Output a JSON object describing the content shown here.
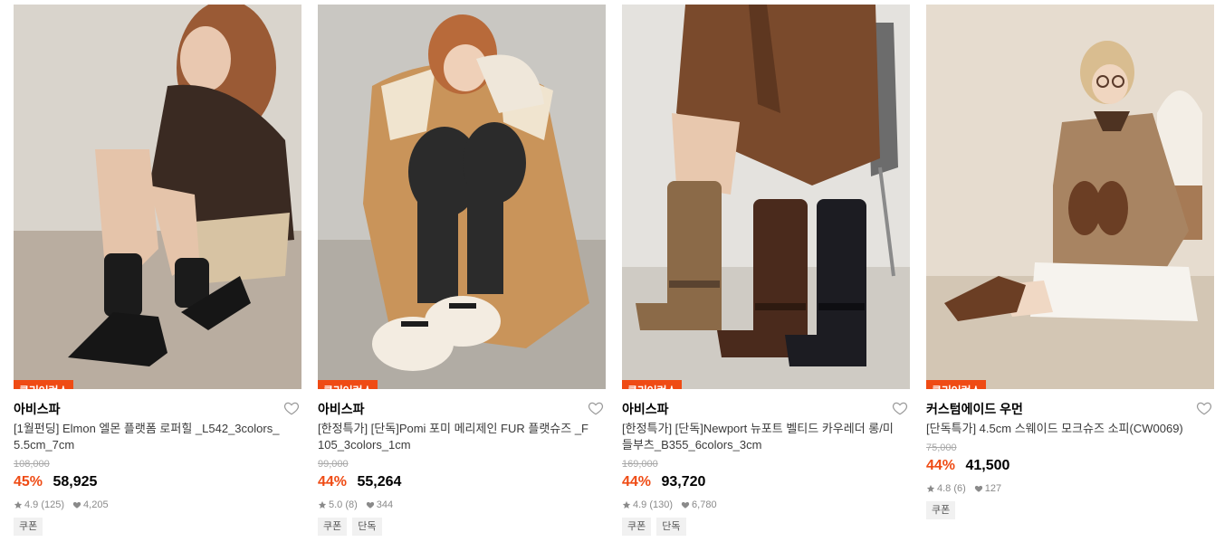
{
  "products": [
    {
      "badge": "클리어런스",
      "brand": "아비스파",
      "title": "[1월펀딩] Elmon 엘몬 플랫폼 로퍼힐 _L542_3colors_5.5cm_7cm",
      "original_price": "108,000",
      "discount": "45%",
      "price": "58,925",
      "rating": "4.9 (125)",
      "likes": "4,205",
      "tags": [
        "쿠폰"
      ]
    },
    {
      "badge": "클리어런스",
      "brand": "아비스파",
      "title": "[한정특가] [단독]Pomi 포미 메리제인 FUR 플랫슈즈 _F105_3colors_1cm",
      "original_price": "99,000",
      "discount": "44%",
      "price": "55,264",
      "rating": "5.0 (8)",
      "likes": "344",
      "tags": [
        "쿠폰",
        "단독"
      ]
    },
    {
      "badge": "클리어런스",
      "brand": "아비스파",
      "title": "[한정특가] [단독]Newport 뉴포트 벨티드 카우레더 롱/미들부츠_B355_6colors_3cm",
      "original_price": "169,000",
      "discount": "44%",
      "price": "93,720",
      "rating": "4.9 (130)",
      "likes": "6,780",
      "tags": [
        "쿠폰",
        "단독"
      ]
    },
    {
      "badge": "클리어런스",
      "brand": "커스텀에이드 우먼",
      "title": "[단독특가] 4.5cm 스웨이드 모크슈즈 소피(CW0069)",
      "original_price": "75,000",
      "discount": "44%",
      "price": "41,500",
      "rating": "4.8 (6)",
      "likes": "127",
      "tags": [
        "쿠폰"
      ]
    }
  ],
  "colors": {
    "accent": "#ef4b14",
    "badge_bg": "#ef4b14",
    "muted": "#8a8a8a",
    "tag_bg": "#f1f1f1"
  },
  "icons": {
    "wishlist": "heart-outline-icon",
    "rating": "star-icon",
    "likes": "heart-filled-icon"
  }
}
